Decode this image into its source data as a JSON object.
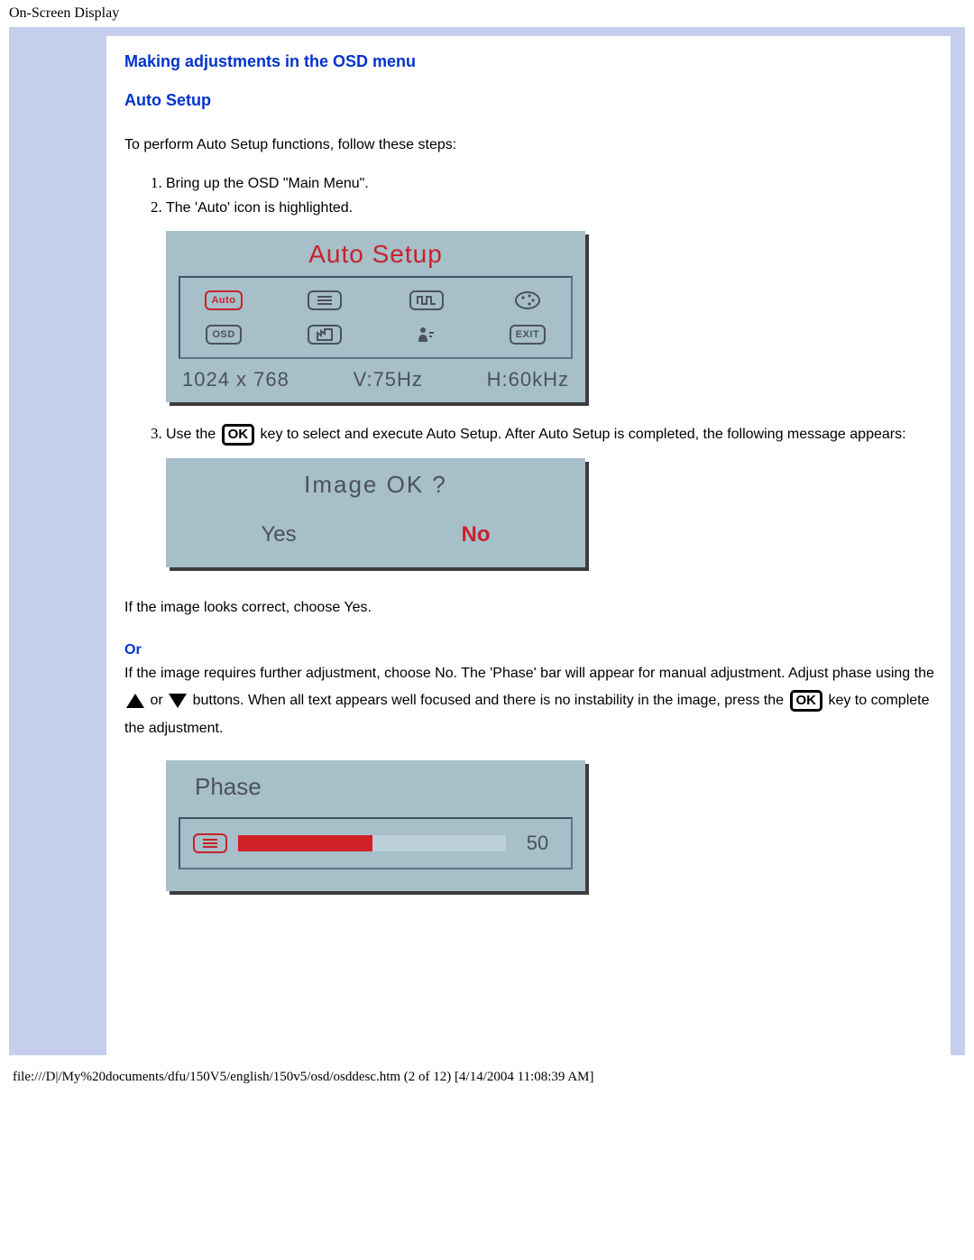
{
  "page_header": "On-Screen Display",
  "heading_main": "Making adjustments in the OSD menu",
  "heading_sub": "Auto Setup",
  "intro": "To perform Auto Setup functions, follow these steps:",
  "steps": {
    "s1": "Bring up the OSD \"Main Menu\".",
    "s2": "The 'Auto' icon is highlighted.",
    "s3a": "Use the ",
    "s3b": " key to select and execute Auto Setup. After Auto Setup is completed, the following message appears:"
  },
  "osd1": {
    "title": "Auto Setup",
    "icons": {
      "auto": "Auto",
      "osd_label": "OSD",
      "exit_label": "EXIT"
    },
    "status_res": "1024 x 768",
    "status_v": "V:75Hz",
    "status_h": "H:60kHz"
  },
  "osd2": {
    "title": "Image OK ?",
    "yes": "Yes",
    "no": "No"
  },
  "after_img": "If the image looks correct, choose Yes.",
  "or_label": "Or",
  "or_body_a": "If the image requires further adjustment, choose No. The 'Phase' bar will appear for manual adjustment. Adjust phase using the ",
  "or_body_b": " or ",
  "or_body_c": " buttons. When all text appears well focused and there is no instability in the image, press the ",
  "or_body_d": " key to complete the adjustment.",
  "osd3": {
    "title": "Phase",
    "value": "50"
  },
  "ok_key": "OK",
  "footer": "file:///D|/My%20documents/dfu/150V5/english/150v5/osd/osddesc.htm (2 of 12) [4/14/2004 11:08:39 AM]"
}
